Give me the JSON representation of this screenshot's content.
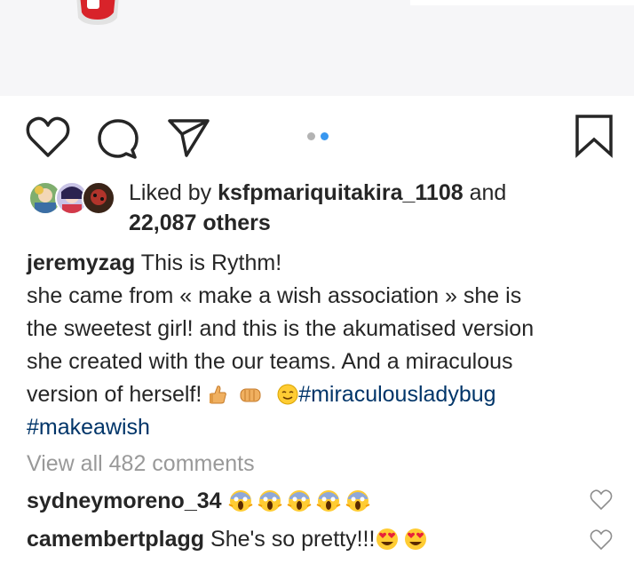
{
  "post": {
    "media": {
      "carousel_total": 2,
      "carousel_active": 2
    },
    "actions": {
      "like_icon": "heart-outline-icon",
      "comment_icon": "speech-bubble-icon",
      "share_icon": "paper-plane-icon",
      "save_icon": "bookmark-outline-icon"
    },
    "likes": {
      "prefix": "Liked by",
      "user": "ksfpmariquitakira_1108",
      "conjunction": "and",
      "others": "22,087 others"
    },
    "caption": {
      "username": "jeremyzag",
      "first_line": "This is Rythm!",
      "line2": "she came from « make a wish association » she is",
      "line3": "the sweetest girl! and this is the akumatised version",
      "line4": "she created with the our teams. And a miraculous",
      "line5": "version of herself!",
      "hashtag1": "#miraculousladybug",
      "hashtag2": "#makeawish"
    },
    "view_comments": "View all 482 comments",
    "comments": [
      {
        "username": "sydneymoreno_34",
        "text": "",
        "emoji": "screaming-face-emoji x5"
      },
      {
        "username": "camembertplagg",
        "text": "She's so pretty!!!",
        "emoji": "heart-eyes-emoji x2"
      }
    ],
    "colors": {
      "link": "#003569",
      "muted": "#999999",
      "accent": "#3897f0",
      "text": "#262626"
    }
  }
}
